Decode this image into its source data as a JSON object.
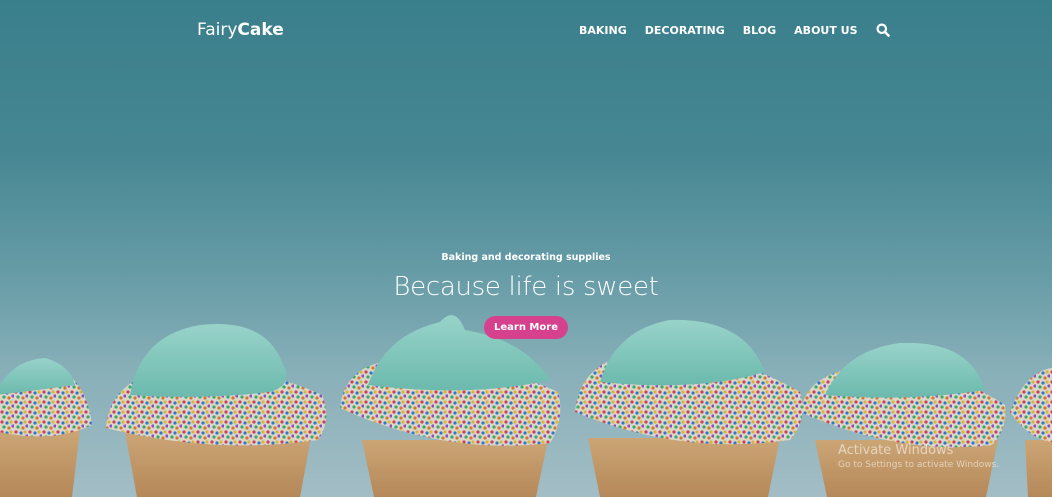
{
  "brand": {
    "light": "Fairy",
    "bold": "Cake"
  },
  "nav": {
    "items": [
      {
        "label": "BAKING"
      },
      {
        "label": "DECORATING"
      },
      {
        "label": "BLOG"
      },
      {
        "label": "ABOUT US"
      }
    ],
    "search_icon": "search-icon"
  },
  "hero": {
    "tagline": "Baking and decorating supplies",
    "headline": "Because life is sweet",
    "cta_label": "Learn More",
    "background_image": "row of cupcakes with teal frosting and rainbow sprinkles"
  },
  "watermark": {
    "title": "Activate Windows",
    "subtitle": "Go to Settings to activate Windows."
  },
  "colors": {
    "accent": "#d6418d",
    "sky_top": "#3c8591",
    "sky_bottom": "#b4cbd3",
    "frosting": "#86d4c6",
    "liner": "#dba56a"
  }
}
